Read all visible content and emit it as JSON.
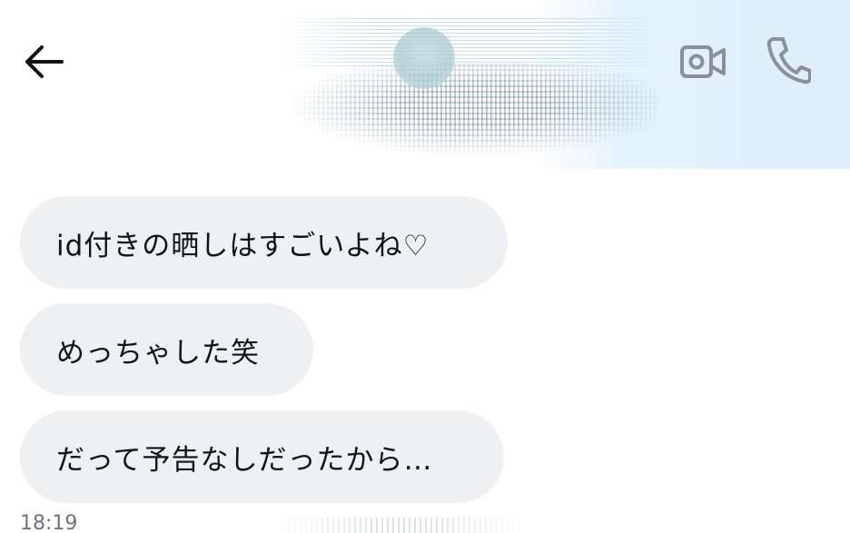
{
  "header": {
    "back_icon": "arrow-left-icon",
    "video_icon": "video-camera-icon",
    "call_icon": "phone-icon",
    "icon_color": "#8a9097"
  },
  "messages": [
    {
      "text": "id付きの晒しはすごいよね♡"
    },
    {
      "text": "めっちゃした笑"
    },
    {
      "text": "だって予告なしだったから…"
    }
  ],
  "timestamp": "18:19",
  "colors": {
    "bubble_background": "#eef0f2",
    "text": "#0f1419",
    "timestamp": "#6b7480",
    "header_wash": "#ddeef9"
  }
}
